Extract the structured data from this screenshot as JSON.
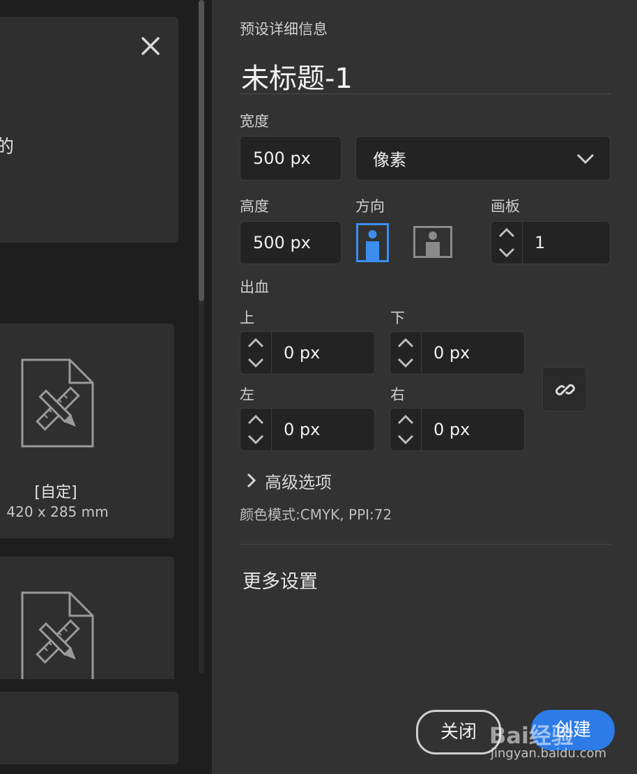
{
  "left_panel": {
    "top_card_partial_text": "的",
    "preset_card": {
      "name": "[自定]",
      "size": "420 x 285 mm",
      "icon": "document-pencil-ruler-icon"
    }
  },
  "details": {
    "section_title": "预设详细信息",
    "doc_name": "未标题-1",
    "width_label": "宽度",
    "width_value": "500 px",
    "unit_value": "像素",
    "height_label": "高度",
    "height_value": "500 px",
    "orientation_label": "方向",
    "artboard_label": "画板",
    "artboard_value": "1",
    "bleed_label": "出血",
    "bleed_top_label": "上",
    "bleed_top_value": "0 px",
    "bleed_bottom_label": "下",
    "bleed_bottom_value": "0 px",
    "bleed_left_label": "左",
    "bleed_left_value": "0 px",
    "bleed_right_label": "右",
    "bleed_right_value": "0 px",
    "advanced_label": "高级选项",
    "color_mode": "颜色模式:CMYK, PPI:72",
    "more_settings": "更多设置"
  },
  "footer": {
    "close_label": "关闭",
    "create_label": "创建",
    "watermark_text": "Bai经验",
    "watermark_url": "jingyan.baidu.com"
  },
  "colors": {
    "accent": "#2d7be6",
    "panel": "#323232",
    "field": "#232323"
  }
}
